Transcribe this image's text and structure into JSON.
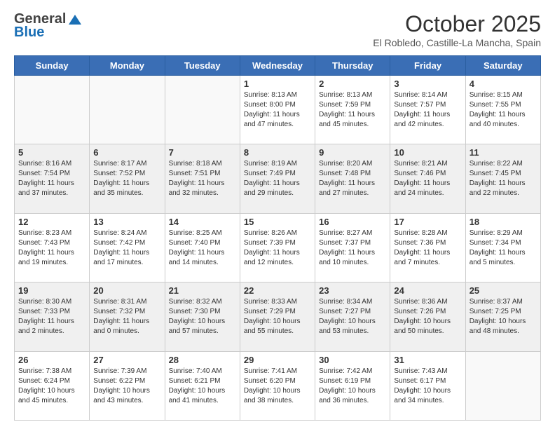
{
  "header": {
    "logo_general": "General",
    "logo_blue": "Blue",
    "title": "October 2025",
    "location": "El Robledo, Castille-La Mancha, Spain"
  },
  "weekdays": [
    "Sunday",
    "Monday",
    "Tuesday",
    "Wednesday",
    "Thursday",
    "Friday",
    "Saturday"
  ],
  "weeks": [
    {
      "alt": false,
      "days": [
        {
          "num": "",
          "info": ""
        },
        {
          "num": "",
          "info": ""
        },
        {
          "num": "",
          "info": ""
        },
        {
          "num": "1",
          "info": "Sunrise: 8:13 AM\nSunset: 8:00 PM\nDaylight: 11 hours\nand 47 minutes."
        },
        {
          "num": "2",
          "info": "Sunrise: 8:13 AM\nSunset: 7:59 PM\nDaylight: 11 hours\nand 45 minutes."
        },
        {
          "num": "3",
          "info": "Sunrise: 8:14 AM\nSunset: 7:57 PM\nDaylight: 11 hours\nand 42 minutes."
        },
        {
          "num": "4",
          "info": "Sunrise: 8:15 AM\nSunset: 7:55 PM\nDaylight: 11 hours\nand 40 minutes."
        }
      ]
    },
    {
      "alt": true,
      "days": [
        {
          "num": "5",
          "info": "Sunrise: 8:16 AM\nSunset: 7:54 PM\nDaylight: 11 hours\nand 37 minutes."
        },
        {
          "num": "6",
          "info": "Sunrise: 8:17 AM\nSunset: 7:52 PM\nDaylight: 11 hours\nand 35 minutes."
        },
        {
          "num": "7",
          "info": "Sunrise: 8:18 AM\nSunset: 7:51 PM\nDaylight: 11 hours\nand 32 minutes."
        },
        {
          "num": "8",
          "info": "Sunrise: 8:19 AM\nSunset: 7:49 PM\nDaylight: 11 hours\nand 29 minutes."
        },
        {
          "num": "9",
          "info": "Sunrise: 8:20 AM\nSunset: 7:48 PM\nDaylight: 11 hours\nand 27 minutes."
        },
        {
          "num": "10",
          "info": "Sunrise: 8:21 AM\nSunset: 7:46 PM\nDaylight: 11 hours\nand 24 minutes."
        },
        {
          "num": "11",
          "info": "Sunrise: 8:22 AM\nSunset: 7:45 PM\nDaylight: 11 hours\nand 22 minutes."
        }
      ]
    },
    {
      "alt": false,
      "days": [
        {
          "num": "12",
          "info": "Sunrise: 8:23 AM\nSunset: 7:43 PM\nDaylight: 11 hours\nand 19 minutes."
        },
        {
          "num": "13",
          "info": "Sunrise: 8:24 AM\nSunset: 7:42 PM\nDaylight: 11 hours\nand 17 minutes."
        },
        {
          "num": "14",
          "info": "Sunrise: 8:25 AM\nSunset: 7:40 PM\nDaylight: 11 hours\nand 14 minutes."
        },
        {
          "num": "15",
          "info": "Sunrise: 8:26 AM\nSunset: 7:39 PM\nDaylight: 11 hours\nand 12 minutes."
        },
        {
          "num": "16",
          "info": "Sunrise: 8:27 AM\nSunset: 7:37 PM\nDaylight: 11 hours\nand 10 minutes."
        },
        {
          "num": "17",
          "info": "Sunrise: 8:28 AM\nSunset: 7:36 PM\nDaylight: 11 hours\nand 7 minutes."
        },
        {
          "num": "18",
          "info": "Sunrise: 8:29 AM\nSunset: 7:34 PM\nDaylight: 11 hours\nand 5 minutes."
        }
      ]
    },
    {
      "alt": true,
      "days": [
        {
          "num": "19",
          "info": "Sunrise: 8:30 AM\nSunset: 7:33 PM\nDaylight: 11 hours\nand 2 minutes."
        },
        {
          "num": "20",
          "info": "Sunrise: 8:31 AM\nSunset: 7:32 PM\nDaylight: 11 hours\nand 0 minutes."
        },
        {
          "num": "21",
          "info": "Sunrise: 8:32 AM\nSunset: 7:30 PM\nDaylight: 10 hours\nand 57 minutes."
        },
        {
          "num": "22",
          "info": "Sunrise: 8:33 AM\nSunset: 7:29 PM\nDaylight: 10 hours\nand 55 minutes."
        },
        {
          "num": "23",
          "info": "Sunrise: 8:34 AM\nSunset: 7:27 PM\nDaylight: 10 hours\nand 53 minutes."
        },
        {
          "num": "24",
          "info": "Sunrise: 8:36 AM\nSunset: 7:26 PM\nDaylight: 10 hours\nand 50 minutes."
        },
        {
          "num": "25",
          "info": "Sunrise: 8:37 AM\nSunset: 7:25 PM\nDaylight: 10 hours\nand 48 minutes."
        }
      ]
    },
    {
      "alt": false,
      "days": [
        {
          "num": "26",
          "info": "Sunrise: 7:38 AM\nSunset: 6:24 PM\nDaylight: 10 hours\nand 45 minutes."
        },
        {
          "num": "27",
          "info": "Sunrise: 7:39 AM\nSunset: 6:22 PM\nDaylight: 10 hours\nand 43 minutes."
        },
        {
          "num": "28",
          "info": "Sunrise: 7:40 AM\nSunset: 6:21 PM\nDaylight: 10 hours\nand 41 minutes."
        },
        {
          "num": "29",
          "info": "Sunrise: 7:41 AM\nSunset: 6:20 PM\nDaylight: 10 hours\nand 38 minutes."
        },
        {
          "num": "30",
          "info": "Sunrise: 7:42 AM\nSunset: 6:19 PM\nDaylight: 10 hours\nand 36 minutes."
        },
        {
          "num": "31",
          "info": "Sunrise: 7:43 AM\nSunset: 6:17 PM\nDaylight: 10 hours\nand 34 minutes."
        },
        {
          "num": "",
          "info": ""
        }
      ]
    }
  ]
}
